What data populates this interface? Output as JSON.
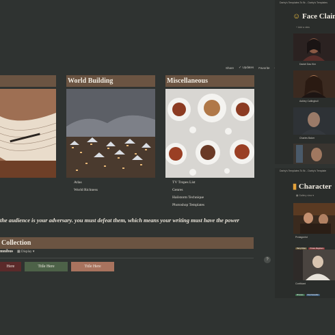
{
  "toolbar": {
    "share": "Share",
    "updates": "Updates",
    "favorite": "Favorite",
    "more": "•••"
  },
  "sections": [
    {
      "title": "",
      "items": []
    },
    {
      "title": "World Building",
      "items": [
        "Atlas",
        "World Richness"
      ]
    },
    {
      "title": "Miscellaneous",
      "items": [
        "TV Tropes List",
        "Genres",
        "Hailstorm Technique",
        "Photoshop Templates"
      ]
    }
  ],
  "quote": "the audience is your adversary. you must defeat them, which means your writing must have the power",
  "collection": {
    "title": "Collection",
    "view": "mnibus",
    "display": "Display",
    "thumbs": [
      "Here",
      "Title Here",
      "Title Here"
    ]
  },
  "help": "?",
  "face_panel": {
    "bar": "Darby's Templates To Br...   Darby's Templates",
    "title": "Face Clain",
    "add_view": "Add a view",
    "cards": [
      "Daniel Das Kim",
      "Ashley Callingbull",
      "Charles Baker"
    ]
  },
  "char_panel": {
    "bar": "Darby's Templates To Br...   Darby's Template",
    "title": "Character",
    "view": "Gallery view",
    "cards": [
      {
        "label": "Protagonist",
        "tags": [
          "Harry Potter",
          "Private Magicians"
        ]
      },
      {
        "label": "Confidant",
        "tags": [
          "Princess",
          "Post Somethin"
        ]
      }
    ]
  },
  "colors": {
    "background": "#2f3331",
    "section_header": "#6b5442",
    "panel": "#2a2d2b"
  }
}
